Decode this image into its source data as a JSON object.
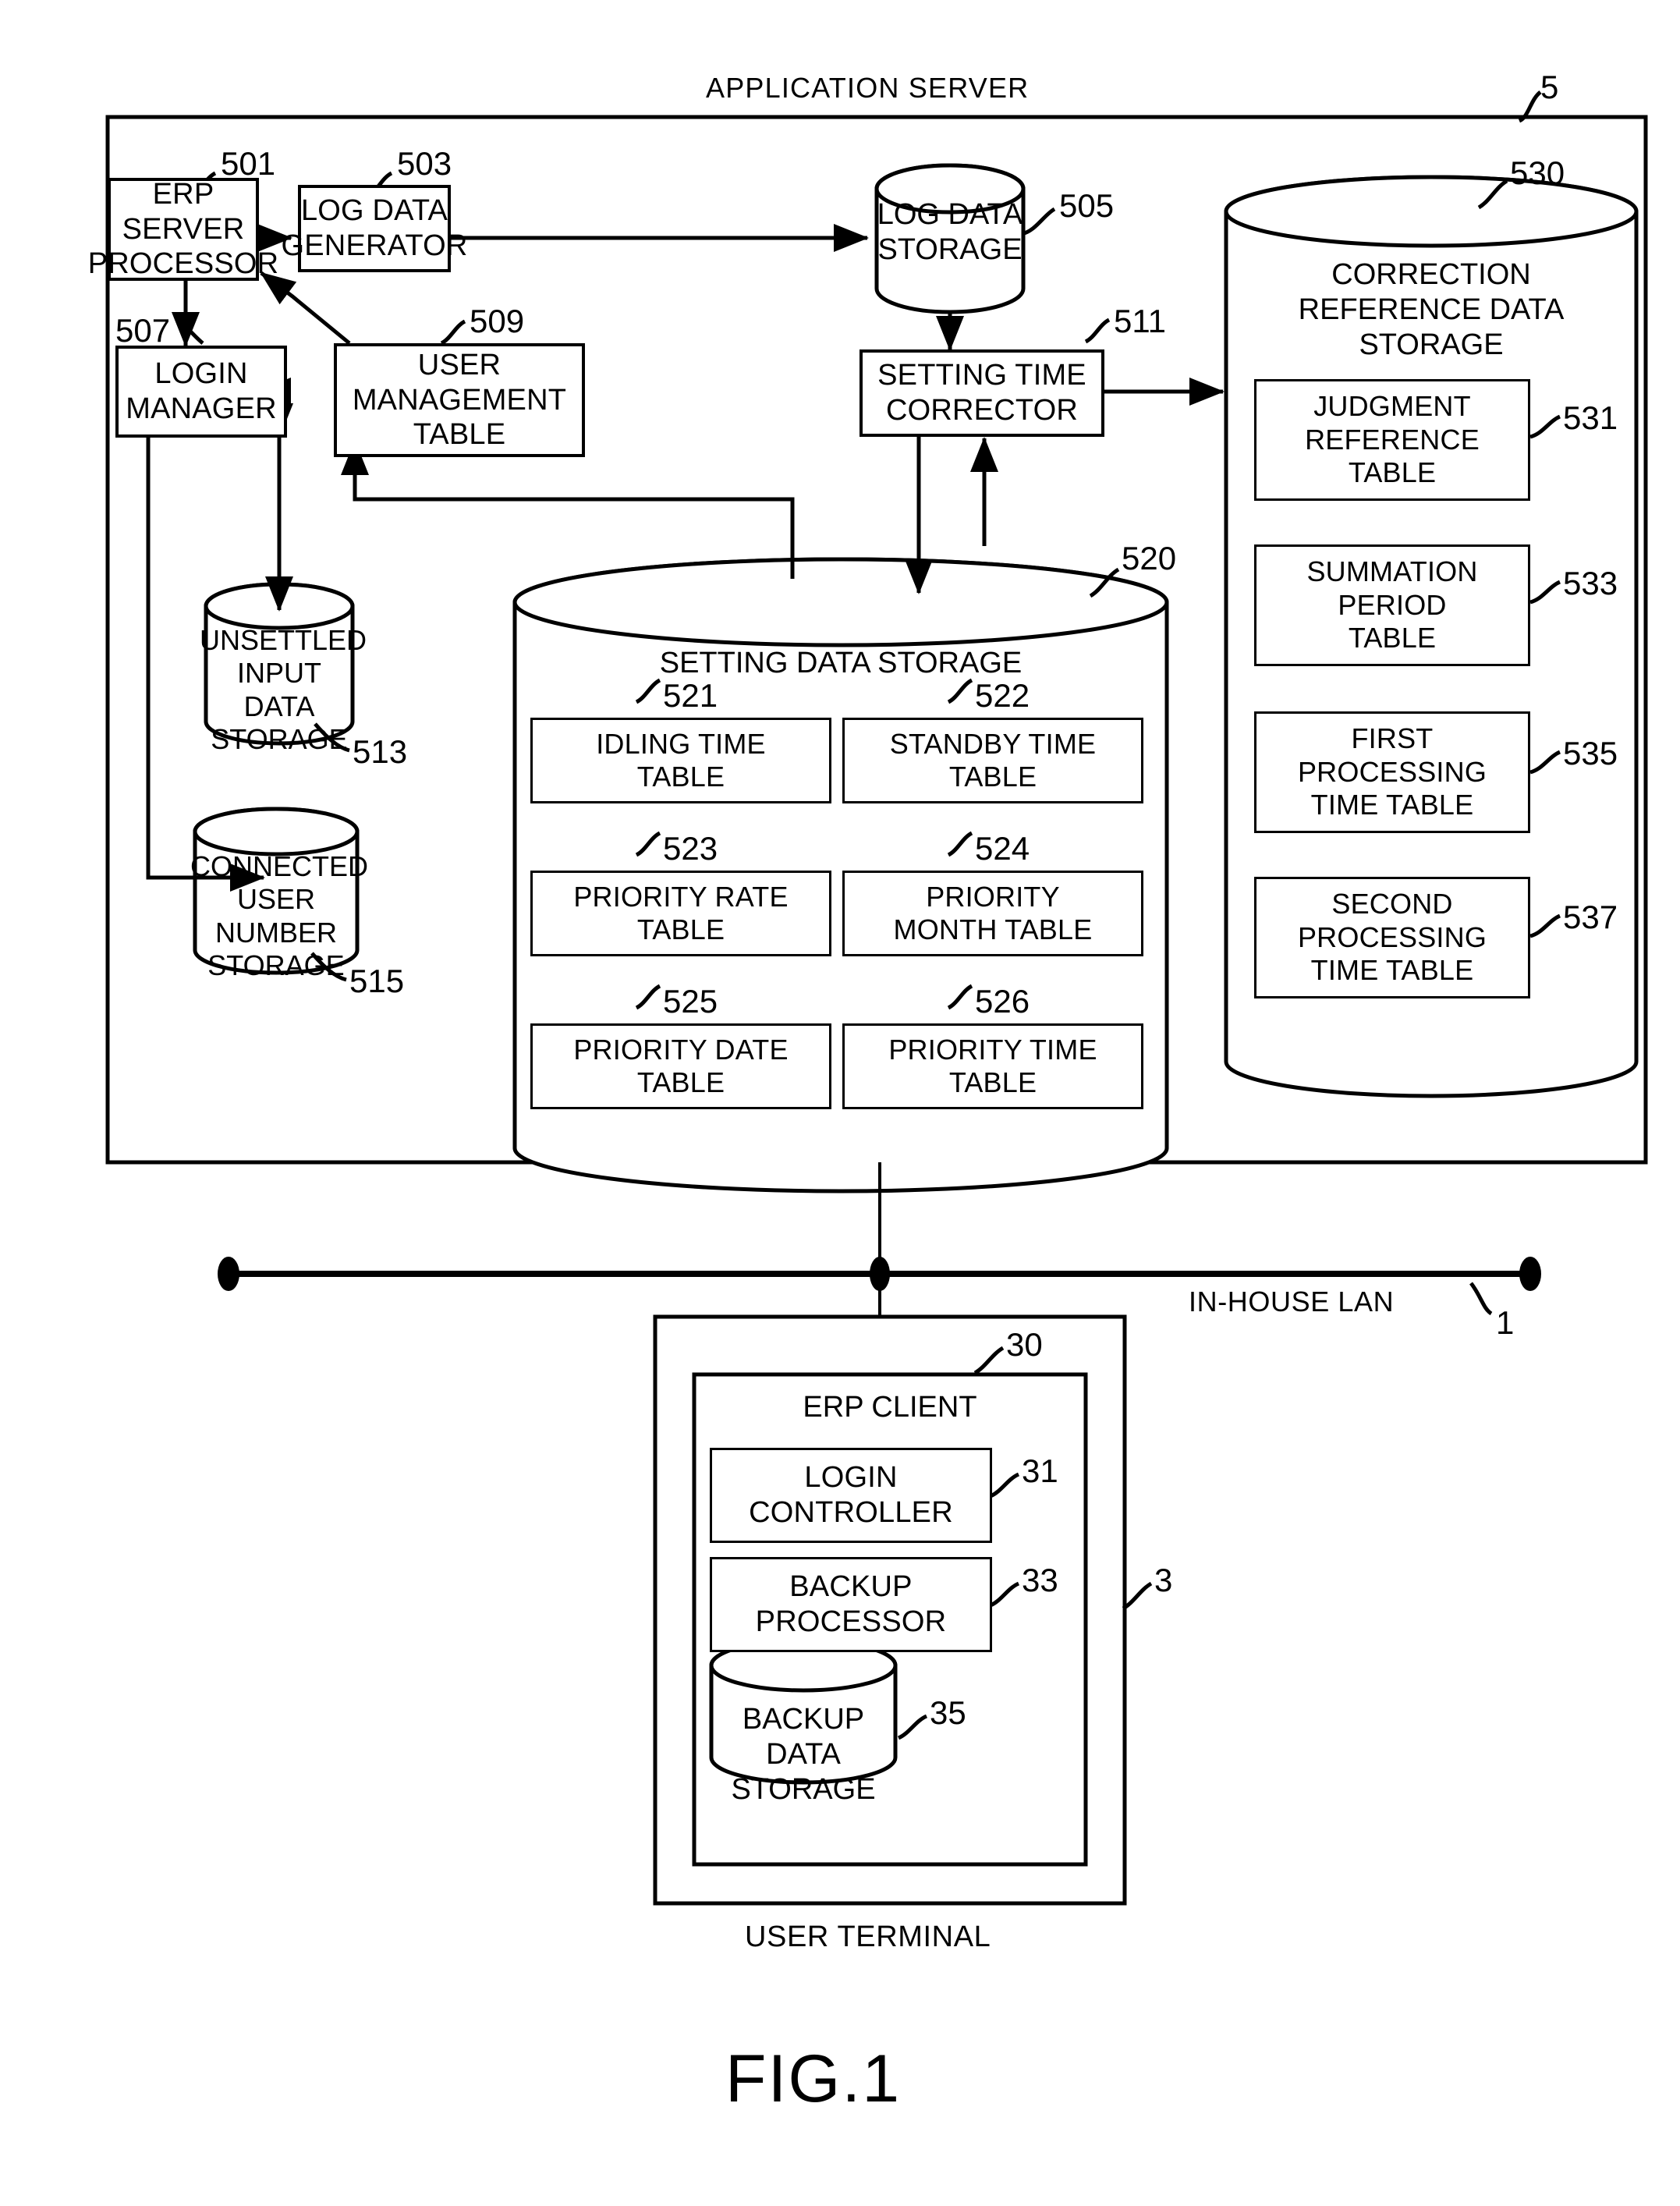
{
  "figure": {
    "caption": "FIG.1",
    "server_title": "APPLICATION SERVER",
    "server_ref": "5",
    "terminal_caption": "USER TERMINAL",
    "terminal_ref": "3",
    "lan_label": "IN-HOUSE LAN",
    "lan_ref": "1"
  },
  "server": {
    "blocks": [
      {
        "id": "erp_server_processor",
        "label": "ERP SERVER\nPROCESSOR",
        "ref": "501"
      },
      {
        "id": "log_data_generator",
        "label": "LOG DATA\nGENERATOR",
        "ref": "503"
      },
      {
        "id": "log_data_storage",
        "label": "LOG DATA\nSTORAGE",
        "ref": "505"
      },
      {
        "id": "login_manager",
        "label": "LOGIN\nMANAGER",
        "ref": "507"
      },
      {
        "id": "user_management_table",
        "label": "USER\nMANAGEMENT\nTABLE",
        "ref": "509"
      },
      {
        "id": "setting_time_corrector",
        "label": "SETTING TIME\nCORRECTOR",
        "ref": "511"
      },
      {
        "id": "unsettled_input_data_storage",
        "label": "UNSETTLED\nINPUT DATA\nSTORAGE",
        "ref": "513"
      },
      {
        "id": "connected_user_number_storage",
        "label": "CONNECTED\nUSER NUMBER\nSTORAGE",
        "ref": "515"
      }
    ],
    "setting_data_storage": {
      "label": "SETTING DATA STORAGE",
      "ref": "520",
      "tables": [
        {
          "label": "IDLING TIME\nTABLE",
          "ref": "521"
        },
        {
          "label": "STANDBY TIME\nTABLE",
          "ref": "522"
        },
        {
          "label": "PRIORITY RATE\nTABLE",
          "ref": "523"
        },
        {
          "label": "PRIORITY\nMONTH TABLE",
          "ref": "524"
        },
        {
          "label": "PRIORITY DATE\nTABLE",
          "ref": "525"
        },
        {
          "label": "PRIORITY TIME\nTABLE",
          "ref": "526"
        }
      ]
    },
    "correction_reference_data_storage": {
      "label": "CORRECTION\nREFERENCE DATA\nSTORAGE",
      "ref": "530",
      "tables": [
        {
          "label": "JUDGMENT\nREFERENCE\nTABLE",
          "ref": "531"
        },
        {
          "label": "SUMMATION\nPERIOD\nTABLE",
          "ref": "533"
        },
        {
          "label": "FIRST\nPROCESSING\nTIME TABLE",
          "ref": "535"
        },
        {
          "label": "SECOND\nPROCESSING\nTIME TABLE",
          "ref": "537"
        }
      ]
    }
  },
  "terminal": {
    "erp_client": {
      "label": "ERP CLIENT",
      "ref": "30"
    },
    "blocks": [
      {
        "id": "login_controller",
        "label": "LOGIN\nCONTROLLER",
        "ref": "31"
      },
      {
        "id": "backup_processor",
        "label": "BACKUP\nPROCESSOR",
        "ref": "33"
      },
      {
        "id": "backup_data_storage",
        "label": "BACKUP DATA\nSTORAGE",
        "ref": "35"
      }
    ]
  },
  "colors": {
    "ink": "#000000",
    "paper": "#ffffff"
  }
}
